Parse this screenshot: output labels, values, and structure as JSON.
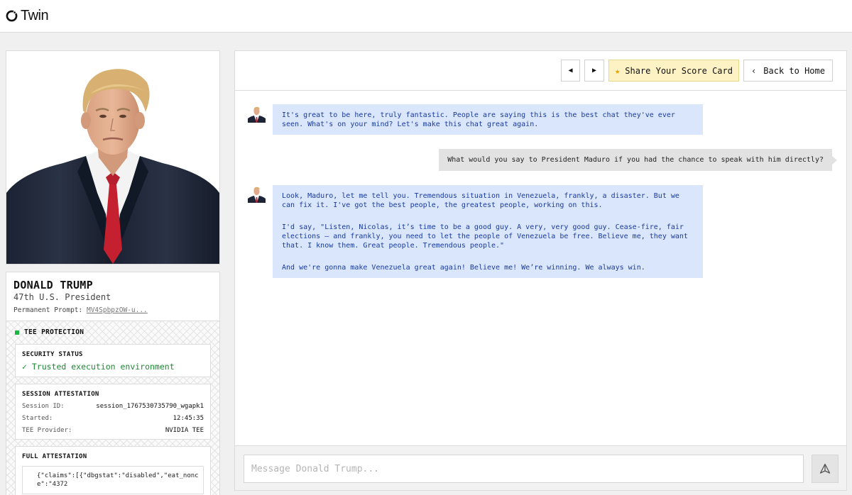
{
  "app": {
    "name": "Twin",
    "logo_icon": "twin-logo-icon"
  },
  "profile": {
    "name": "DONALD TRUMP",
    "title": "47th U.S. President",
    "prompt_label": "Permanent Prompt:",
    "prompt_link": "MV4SpbpzOW-u..."
  },
  "tee": {
    "heading": "TEE PROTECTION",
    "status_color": "#1db446",
    "security": {
      "title": "SECURITY STATUS",
      "value": "✓ Trusted execution environment"
    },
    "session": {
      "title": "SESSION ATTESTATION",
      "rows": [
        {
          "key": "Session ID:",
          "value": "session_1767530735790_wgapk1"
        },
        {
          "key": "Started:",
          "value": "12:45:35"
        },
        {
          "key": "TEE Provider:",
          "value": "NVIDIA TEE"
        }
      ]
    },
    "full": {
      "title": "FULL ATTESTATION",
      "json": "{\"claims\":[{\"dbgstat\":\"disabled\",\"eat_nonce\":\"4372"
    }
  },
  "toolbar": {
    "prev_icon": "◀",
    "next_icon": "▶",
    "share_icon": "★",
    "share_label": "Share Your Score Card",
    "back_icon": "‹",
    "back_label": "Back to Home"
  },
  "messages": [
    {
      "role": "assistant",
      "paragraphs": [
        "It's great to be here, truly fantastic. People are saying this is the best chat they've ever seen. What's on your mind? Let's make this chat great again."
      ]
    },
    {
      "role": "user",
      "text": "What would you say to President Maduro if you had the chance to speak with him directly?"
    },
    {
      "role": "assistant",
      "paragraphs": [
        "Look, Maduro, let me tell you. Tremendous situation in Venezuela, frankly, a disaster. But we can fix it. I've got the best people, the greatest people, working on this.",
        "I'd say, \"Listen, Nicolas, it’s time to be a good guy. A very, very good guy. Cease-fire, fair elections – and frankly, you need to let the people of Venezuela be free. Believe me, they want that. I know them. Great people. Tremendous people.\"",
        "And we're gonna make Venezuela great again! Believe me! We’re winning. We always win."
      ]
    }
  ],
  "composer": {
    "placeholder": "Message Donald Trump...",
    "send_icon": "send-icon"
  },
  "colors": {
    "assistant_bubble": "#d9e6fb",
    "assistant_text": "#1a3a9c",
    "user_bubble": "#e2e2e2",
    "share_bg": "#fdf2c4"
  }
}
